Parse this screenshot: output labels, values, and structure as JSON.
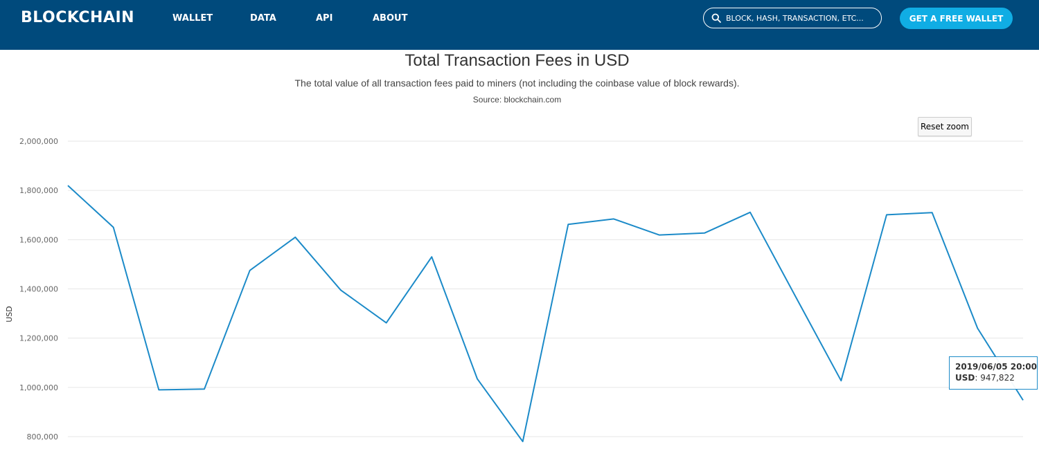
{
  "header": {
    "logo": "BLOCKCHAIN",
    "nav": [
      "WALLET",
      "DATA",
      "API",
      "ABOUT"
    ],
    "search_placeholder": "BLOCK, HASH, TRANSACTION, ETC...",
    "cta_label": "GET A FREE WALLET"
  },
  "colors": {
    "header_bg": "#004a7c",
    "cta_bg": "#10ade4",
    "series_line": "#1b8ac8",
    "grid": "#e6e6e6"
  },
  "icons": {
    "search": "search-icon"
  },
  "chart": {
    "title": "Total Transaction Fees in USD",
    "subtitle": "The total value of all transaction fees paid to miners (not including the coinbase value of block rewards).",
    "source": "Source: blockchain.com",
    "reset_zoom_label": "Reset zoom",
    "tooltip": {
      "date": "2019/06/05 20:00",
      "series_label": "USD",
      "value_text": ": 947,822"
    }
  },
  "chart_data": {
    "type": "line",
    "title": "Total Transaction Fees in USD",
    "ylabel": "USD",
    "ylim": [
      780000,
      2000000
    ],
    "yticks": [
      800000,
      1000000,
      1200000,
      1400000,
      1600000,
      1800000,
      2000000
    ],
    "ytick_labels": [
      "800,000",
      "1,000,000",
      "1,200,000",
      "1,400,000",
      "1,600,000",
      "1,800,000",
      "2,000,000"
    ],
    "grid": true,
    "legend": "none",
    "series": [
      {
        "values": [
          1820000,
          1650000,
          990000,
          993000,
          1475000,
          1610000,
          1395000,
          1262000,
          1530000,
          1035000,
          780000,
          1662000,
          1684000,
          1619000,
          1627000,
          1711000,
          1368000,
          1027000,
          1701000,
          1710000,
          1240000,
          947822
        ]
      }
    ]
  }
}
